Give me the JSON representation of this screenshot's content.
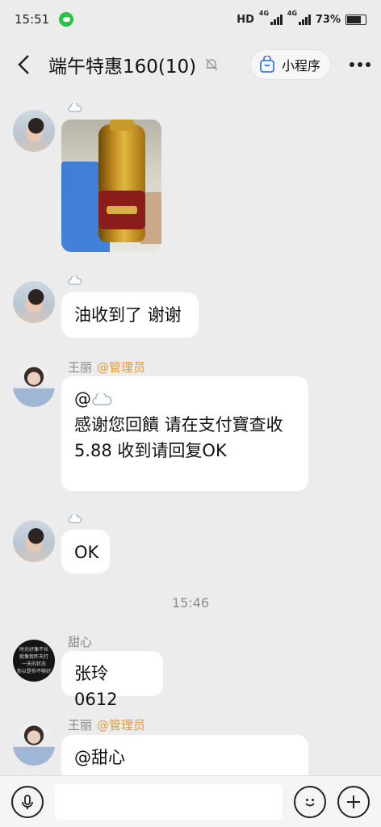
{
  "status": {
    "time": "15:51",
    "network_hd": "HD",
    "network_gen": "4G",
    "battery": "73%"
  },
  "nav": {
    "title": "端午特惠160(10)",
    "mini_program": "小程序"
  },
  "messages": [
    {
      "type": "image",
      "sender_name": "",
      "image_label": "oil bottle photo"
    },
    {
      "type": "text",
      "sender_name": "",
      "text": "油收到了 谢谢"
    },
    {
      "type": "text",
      "sender_name": "王丽",
      "role": "@管理员",
      "line1_prefix": "@",
      "line2": "感谢您回饋 请在支付寶查收",
      "line3": "5.88 收到请回复OK"
    },
    {
      "type": "text",
      "sender_name": "",
      "text": "OK"
    },
    {
      "type": "text",
      "sender_name": "甜心",
      "text": "张玲0612",
      "avatar_text": [
        "时光好像不长",
        "就像我昨天打",
        "一天的状态",
        "你以是你不够好"
      ]
    },
    {
      "type": "text",
      "sender_name": "王丽",
      "role": "@管理员",
      "text": "@甜心"
    }
  ],
  "time_separator": "15:46",
  "icons": {
    "back": "chevron-left-icon",
    "mute": "bell-off-icon",
    "mini": "shopping-bag-icon",
    "more": "more-dots-icon",
    "voice": "microphone-icon",
    "emoji": "smiley-icon",
    "plus": "plus-icon"
  }
}
